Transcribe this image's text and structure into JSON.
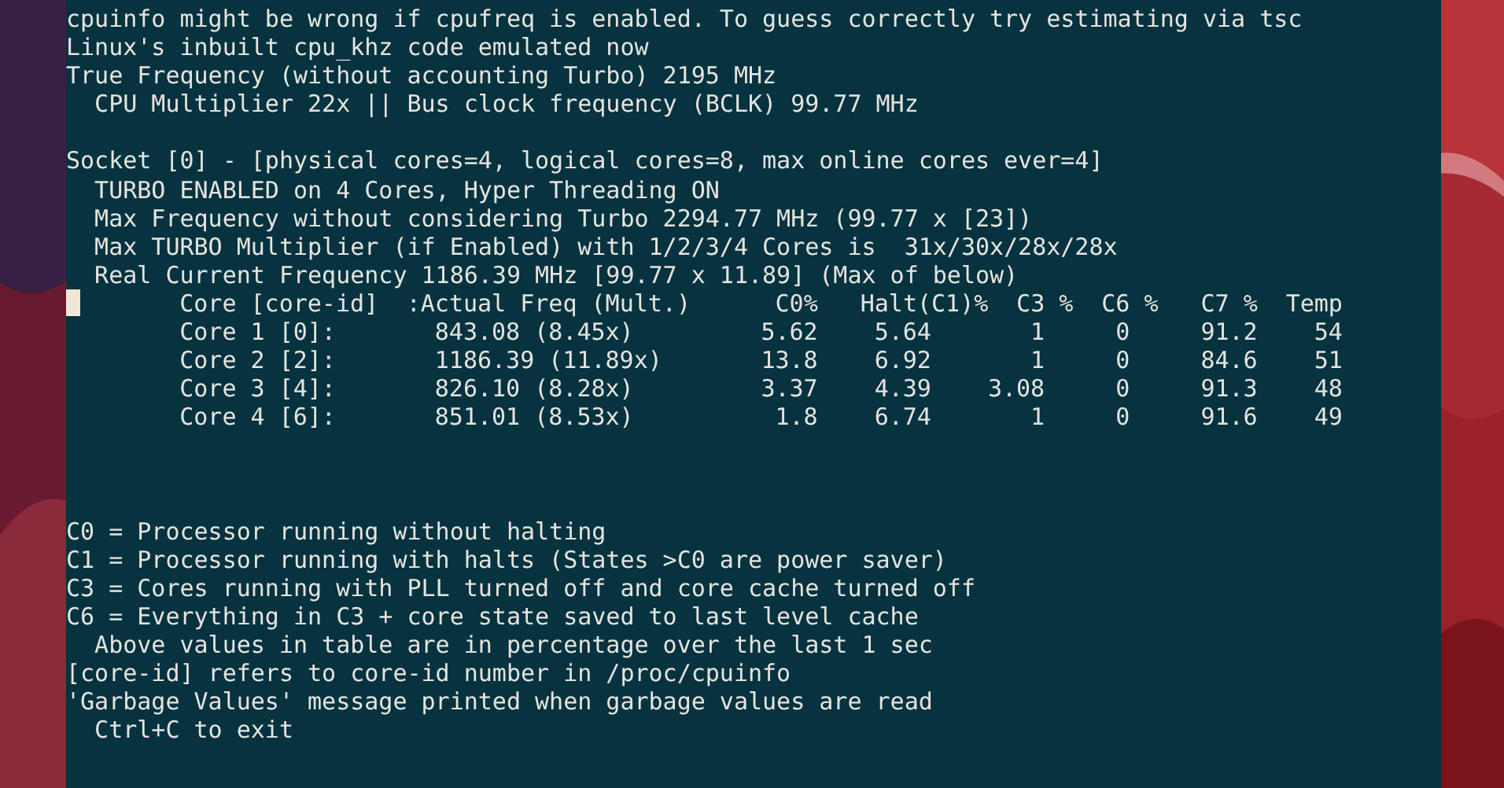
{
  "terminal": {
    "intro_lines": [
      "cpuinfo might be wrong if cpufreq is enabled. To guess correctly try estimating via tsc",
      "Linux's inbuilt cpu_khz code emulated now",
      "True Frequency (without accounting Turbo) 2195 MHz",
      "  CPU Multiplier 22x || Bus clock frequency (BCLK) 99.77 MHz"
    ],
    "socket_lines": [
      "Socket [0] - [physical cores=4, logical cores=8, max online cores ever=4]",
      "  TURBO ENABLED on 4 Cores, Hyper Threading ON",
      "  Max Frequency without considering Turbo 2294.77 MHz (99.77 x [23])",
      "  Max TURBO Multiplier (if Enabled) with 1/2/3/4 Cores is  31x/30x/28x/28x",
      "  Real Current Frequency 1186.39 MHz [99.77 x 11.89] (Max of below)"
    ],
    "table": {
      "columns": [
        "Core [core-id]",
        ":Actual Freq (Mult.)",
        "C0%",
        "Halt(C1)%",
        "C3 %",
        "C6 %",
        "C7 %",
        "Temp"
      ],
      "rows": [
        [
          "Core 1 [0]:",
          "843.08 (8.45x)",
          "5.62",
          "5.64",
          "1",
          "0",
          "91.2",
          "54"
        ],
        [
          "Core 2 [2]:",
          "1186.39 (11.89x)",
          "13.8",
          "6.92",
          "1",
          "0",
          "84.6",
          "51"
        ],
        [
          "Core 3 [4]:",
          "826.10 (8.28x)",
          "3.37",
          "4.39",
          "3.08",
          "0",
          "91.3",
          "48"
        ],
        [
          "Core 4 [6]:",
          "851.01 (8.53x)",
          "1.8",
          "6.74",
          "1",
          "0",
          "91.6",
          "49"
        ]
      ]
    },
    "legend_lines": [
      "C0 = Processor running without halting",
      "C1 = Processor running with halts (States >C0 are power saver)",
      "C3 = Cores running with PLL turned off and core cache turned off",
      "C6 = Everything in C3 + core state saved to last level cache",
      "  Above values in table are in percentage over the last 1 sec",
      "[core-id] refers to core-id number in /proc/cpuinfo",
      "'Garbage Values' message printed when garbage values are read",
      "  Ctrl+C to exit"
    ]
  }
}
